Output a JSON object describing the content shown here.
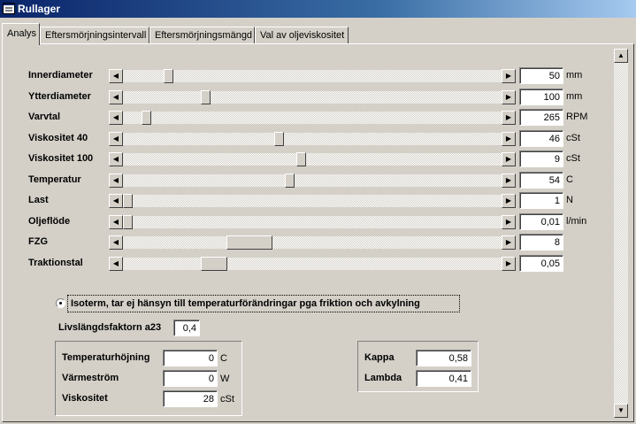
{
  "window": {
    "title": "Rullager"
  },
  "tabs": [
    {
      "label": "Analys",
      "active": true
    },
    {
      "label": "Eftersmörjningsintervall",
      "active": false
    },
    {
      "label": "Eftersmörjningsmängd",
      "active": false
    },
    {
      "label": "Val av oljeviskositet",
      "active": false
    }
  ],
  "rows": [
    {
      "label": "Innerdiameter",
      "value": "50",
      "unit": "mm",
      "slider_fraction": 0.11
    },
    {
      "label": "Ytterdiameter",
      "value": "100",
      "unit": "mm",
      "slider_fraction": 0.21
    },
    {
      "label": "Varvtal",
      "value": "265",
      "unit": "RPM",
      "slider_fraction": 0.05
    },
    {
      "label": "Viskositet 40",
      "value": "46",
      "unit": "cSt",
      "slider_fraction": 0.41
    },
    {
      "label": "Viskositet 100",
      "value": "9",
      "unit": "cSt",
      "slider_fraction": 0.47
    },
    {
      "label": "Temperatur",
      "value": "54",
      "unit": "C",
      "slider_fraction": 0.44
    },
    {
      "label": "Last",
      "value": "1",
      "unit": "N",
      "slider_fraction": 0.0
    },
    {
      "label": "Oljeflöde",
      "value": "0,01",
      "unit": "l/min",
      "slider_fraction": 0.0
    },
    {
      "label": "FZG",
      "value": "8",
      "unit": "",
      "slider_fraction": 0.31,
      "thumb_wide": true
    },
    {
      "label": "Traktionstal",
      "value": "0,05",
      "unit": "",
      "slider_fraction": 0.22,
      "thumb_medium": true
    }
  ],
  "isotherm": {
    "label": "Isoterm, tar ej hänsyn till temperaturförändringar pga friktion och avkylning",
    "checked": true
  },
  "life_factor": {
    "label": "Livslängdsfaktorn a23",
    "value": "0,4"
  },
  "results_left": [
    {
      "label": "Temperaturhöjning",
      "value": "0",
      "unit": "C"
    },
    {
      "label": "Värmeström",
      "value": "0",
      "unit": "W"
    },
    {
      "label": "Viskositet",
      "value": "28",
      "unit": "cSt"
    }
  ],
  "results_right": [
    {
      "label": "Kappa",
      "value": "0,58"
    },
    {
      "label": "Lambda",
      "value": "0,41"
    }
  ]
}
